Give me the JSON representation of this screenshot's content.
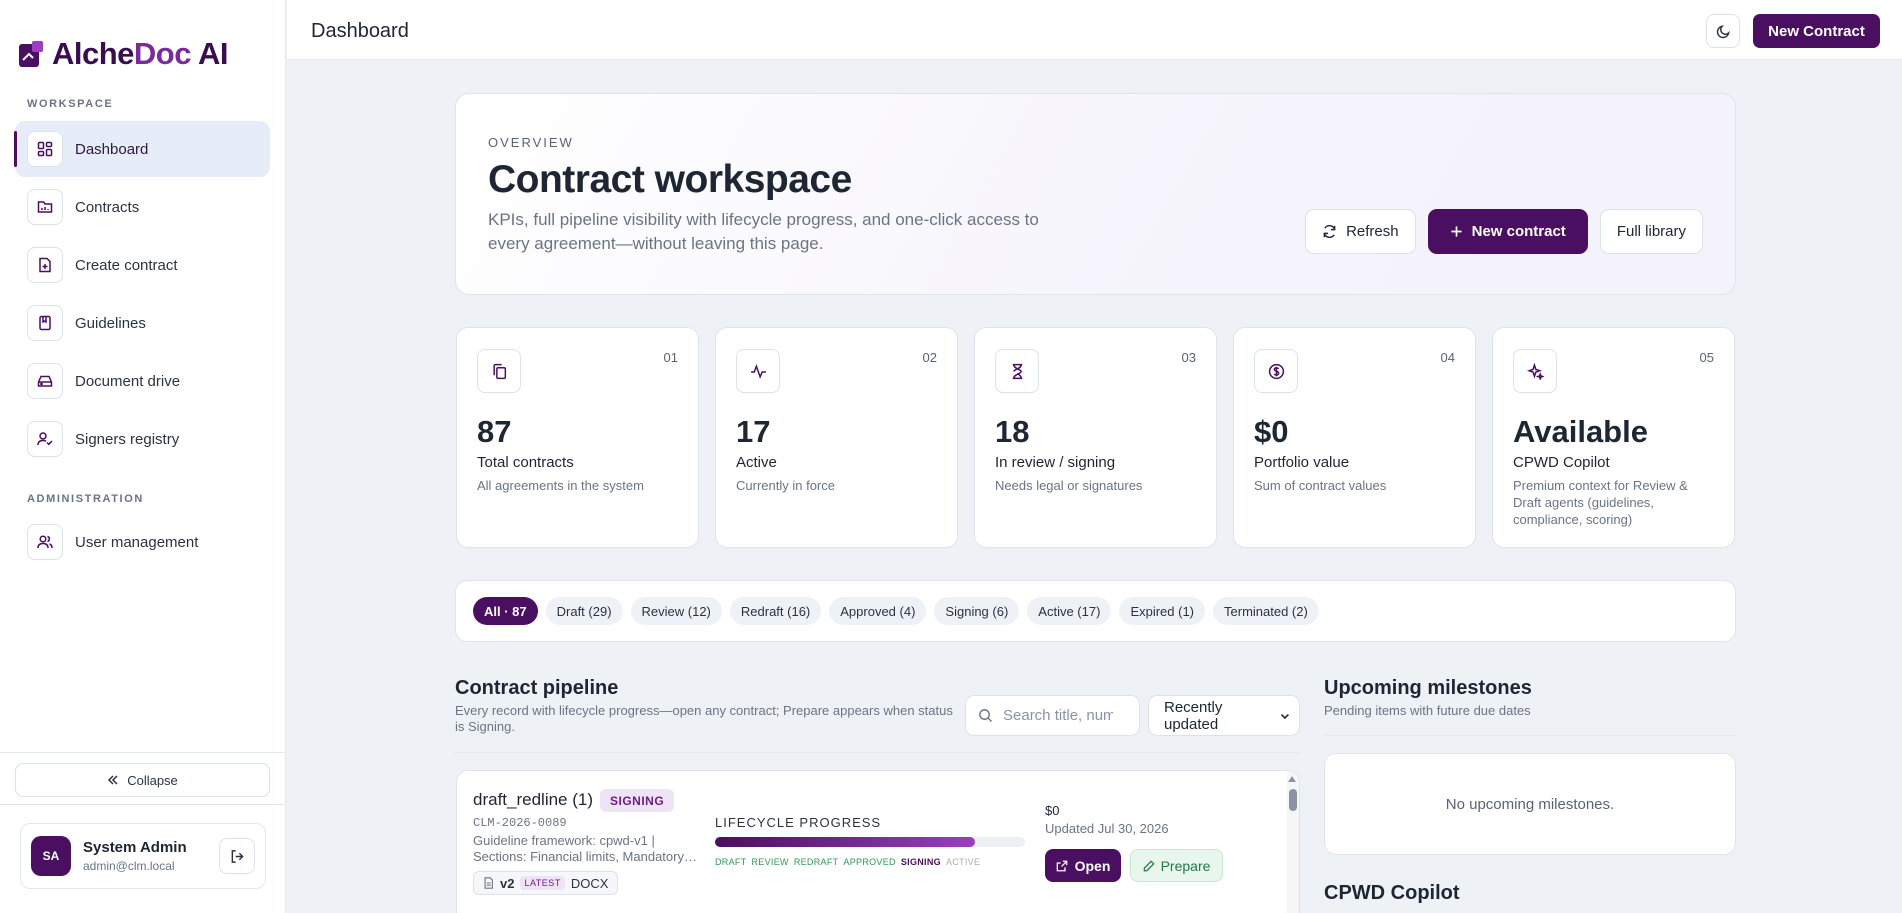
{
  "app": {
    "logo_text_a": "Alche",
    "logo_text_b": "Doc",
    "logo_text_c": " AI"
  },
  "sidebar": {
    "workspace_label": "WORKSPACE",
    "admin_label": "ADMINISTRATION",
    "items": [
      {
        "label": "Dashboard",
        "icon": "dashboard-icon"
      },
      {
        "label": "Contracts",
        "icon": "folder-icon"
      },
      {
        "label": "Create contract",
        "icon": "file-plus-icon"
      },
      {
        "label": "Guidelines",
        "icon": "book-icon"
      },
      {
        "label": "Document drive",
        "icon": "drive-icon"
      },
      {
        "label": "Signers registry",
        "icon": "user-check-icon"
      },
      {
        "label": "User management",
        "icon": "users-icon"
      }
    ],
    "collapse_label": "Collapse",
    "user": {
      "initials": "SA",
      "name": "System Admin",
      "email": "admin@clm.local"
    }
  },
  "topbar": {
    "title": "Dashboard",
    "new_contract_label": "New Contract"
  },
  "hero": {
    "eyebrow": "OVERVIEW",
    "title": "Contract workspace",
    "description": "KPIs, full pipeline visibility with lifecycle progress, and one-click access to every agreement—without leaving this page.",
    "refresh_label": "Refresh",
    "new_contract_label": "New contract",
    "library_label": "Full library"
  },
  "kpis": [
    {
      "num": "01",
      "value": "87",
      "label": "Total contracts",
      "sub": "All agreements in the system",
      "icon": "copy-icon"
    },
    {
      "num": "02",
      "value": "17",
      "label": "Active",
      "sub": "Currently in force",
      "icon": "activity-icon"
    },
    {
      "num": "03",
      "value": "18",
      "label": "In review / signing",
      "sub": "Needs legal or signatures",
      "icon": "hourglass-icon"
    },
    {
      "num": "04",
      "value": "$0",
      "label": "Portfolio value",
      "sub": "Sum of contract values",
      "icon": "dollar-icon"
    },
    {
      "num": "05",
      "value": "Available",
      "label": "CPWD Copilot",
      "sub": "Premium context for Review & Draft agents (guidelines, compliance, scoring)",
      "icon": "sparkles-icon"
    }
  ],
  "filters": [
    {
      "label": "All · 87",
      "active": true
    },
    {
      "label": "Draft (29)"
    },
    {
      "label": "Review (12)"
    },
    {
      "label": "Redraft (16)"
    },
    {
      "label": "Approved (4)"
    },
    {
      "label": "Signing (6)"
    },
    {
      "label": "Active (17)"
    },
    {
      "label": "Expired (1)"
    },
    {
      "label": "Terminated (2)"
    }
  ],
  "pipeline": {
    "title": "Contract pipeline",
    "subtitle": "Every record with lifecycle progress—open any contract; Prepare appears when status is Signing.",
    "search_placeholder": "Search title, number",
    "sort_label": "Recently updated",
    "contract": {
      "title": "draft_redline (1)",
      "status": "SIGNING",
      "id": "CLM-2026-0089",
      "guideline_line1": "Guideline framework: cpwd-v1 |",
      "guideline_line2": "Sections: Financial limits, Mandatory clauses",
      "version": "v2",
      "version_tag": "LATEST",
      "format": "DOCX",
      "progress_label": "LIFECYCLE PROGRESS",
      "progress": 0.84,
      "stages": [
        {
          "label": "DRAFT",
          "state": "done"
        },
        {
          "label": "REVIEW",
          "state": "done"
        },
        {
          "label": "REDRAFT",
          "state": "done"
        },
        {
          "label": "APPROVED",
          "state": "done"
        },
        {
          "label": "SIGNING",
          "state": "current"
        },
        {
          "label": "ACTIVE",
          "state": "future"
        }
      ],
      "value": "$0",
      "updated": "Updated Jul 30, 2026",
      "open_label": "Open",
      "prepare_label": "Prepare"
    }
  },
  "milestones": {
    "title": "Upcoming milestones",
    "subtitle": "Pending items with future due dates",
    "empty": "No upcoming milestones."
  },
  "copilot": {
    "title": "CPWD Copilot"
  },
  "colors": {
    "brand": "#4a0f60",
    "success": "#2f9a55",
    "background": "#eef2f7"
  }
}
